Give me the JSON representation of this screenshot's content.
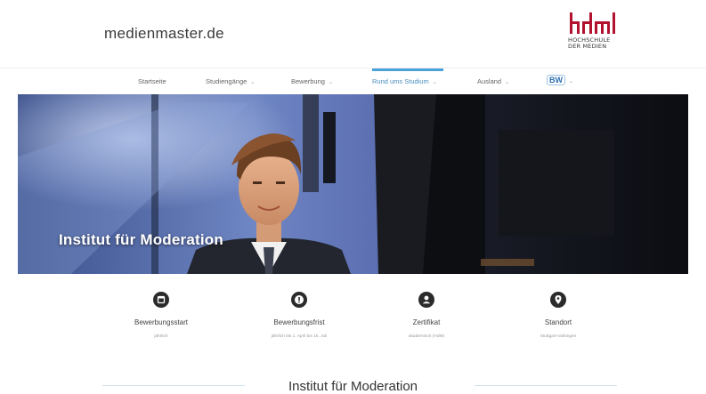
{
  "header": {
    "site_name": "medienmaster.de",
    "logo": {
      "mark": "hdm",
      "caption_line1": "HOCHSCHULE",
      "caption_line2": "DER MEDIEN",
      "color": "#b3122e"
    }
  },
  "nav": {
    "items": [
      {
        "label": "Startseite",
        "has_dropdown": false
      },
      {
        "label": "Studiengänge",
        "has_dropdown": true
      },
      {
        "label": "Bewerbung",
        "has_dropdown": true
      },
      {
        "label": "Rund ums Studium",
        "has_dropdown": true,
        "active": true
      },
      {
        "label": "Ausland",
        "has_dropdown": true
      },
      {
        "label": "BW",
        "has_dropdown": true
      }
    ],
    "dropdown_glyph": "⌄",
    "accent_color": "#4aa3d8"
  },
  "hero": {
    "title": "Institut für Moderation"
  },
  "facts": [
    {
      "icon": "calendar-icon",
      "label": "Bewerbungsstart",
      "value": "jährlich"
    },
    {
      "icon": "info-icon",
      "label": "Bewerbungsfrist",
      "value": "jährlich bis 1. April bis 15. Juli"
    },
    {
      "icon": "person-icon",
      "label": "Zertifikat",
      "value": "akademisch (HdM)"
    },
    {
      "icon": "location-pin-icon",
      "label": "Standort",
      "value": "Stuttgart-Vaihingen"
    }
  ],
  "section": {
    "title": "Institut für Moderation",
    "line_color": "#cfe2ef"
  }
}
